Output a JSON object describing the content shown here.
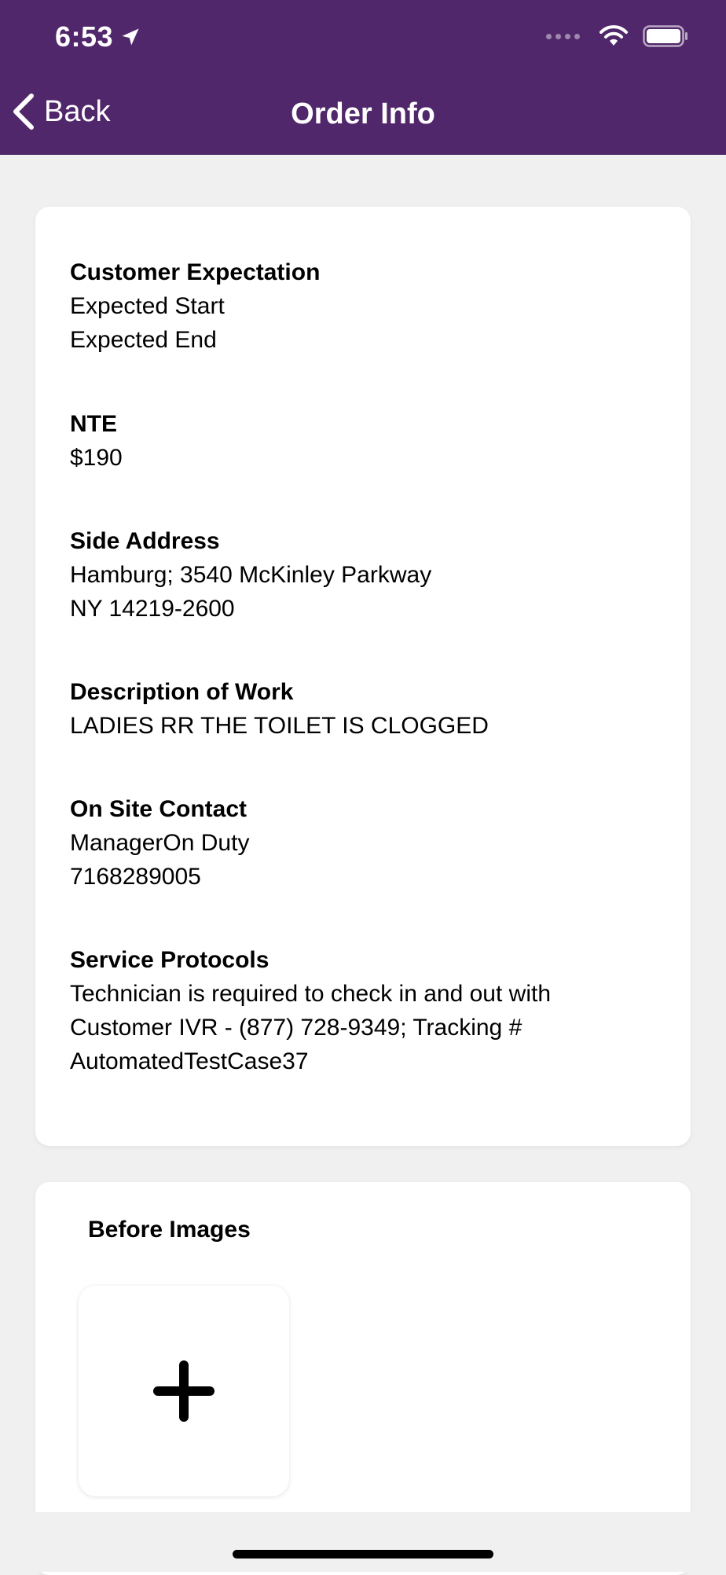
{
  "status_bar": {
    "time": "6:53"
  },
  "nav": {
    "back_label": "Back",
    "title": "Order Info"
  },
  "sections": {
    "customer_expectation": {
      "title": "Customer Expectation",
      "lines": [
        "Expected Start",
        "Expected End"
      ]
    },
    "nte": {
      "title": "NTE",
      "lines": [
        "$190"
      ]
    },
    "side_address": {
      "title": "Side Address",
      "lines": [
        "Hamburg; 3540 McKinley Parkway",
        "NY 14219-2600"
      ]
    },
    "description_of_work": {
      "title": "Description of Work",
      "lines": [
        "LADIES RR THE TOILET IS CLOGGED"
      ]
    },
    "on_site_contact": {
      "title": "On Site Contact",
      "lines": [
        "ManagerOn Duty",
        "7168289005"
      ]
    },
    "service_protocols": {
      "title": "Service Protocols",
      "lines": [
        "Technician is required to check in and out with",
        "Customer IVR - (877) 728-9349; Tracking #",
        "AutomatedTestCase37"
      ]
    }
  },
  "before_images": {
    "title": "Before Images",
    "add_icon": "plus-icon"
  },
  "colors": {
    "header": "#51276b",
    "background": "#f0f0f0",
    "card": "#ffffff"
  }
}
